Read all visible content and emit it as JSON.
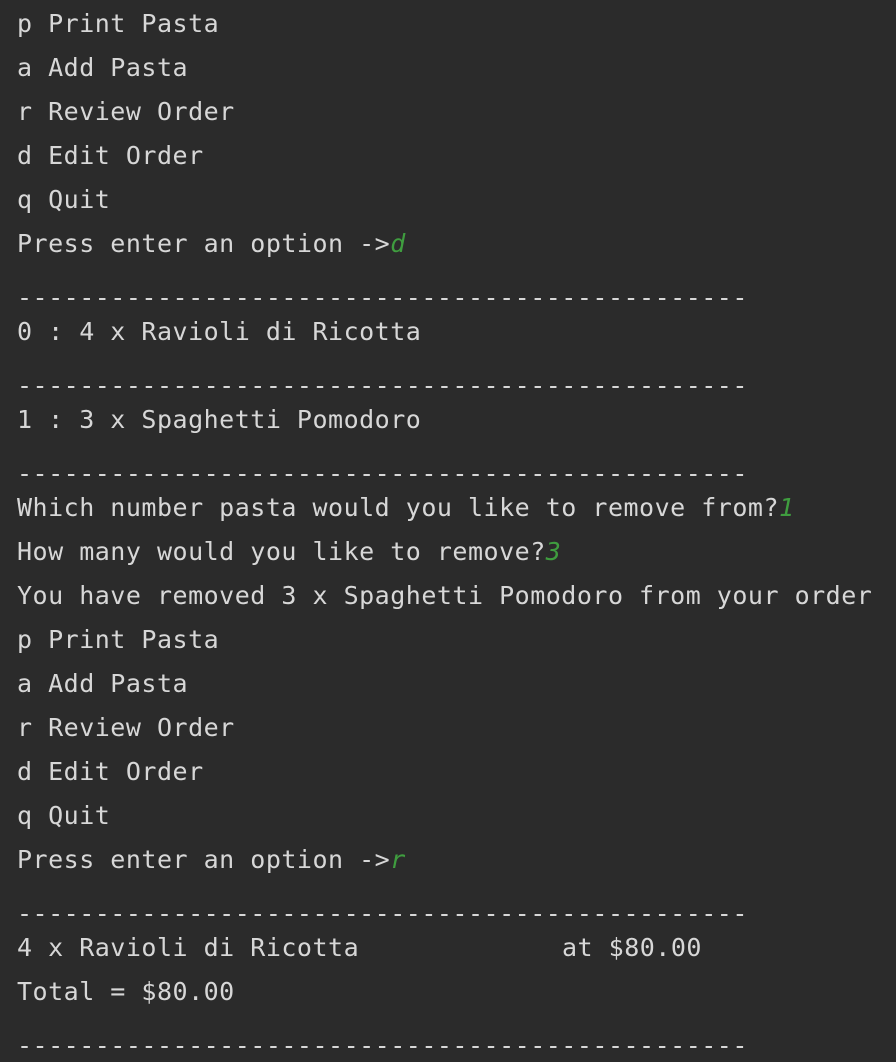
{
  "console": {
    "colors": {
      "background": "#2b2b2b",
      "text": "#d7d7d7",
      "user_input": "#3f9d3f"
    },
    "separator": "-----------------------------------------------",
    "menu1": {
      "p": "p Print Pasta",
      "a": "a Add Pasta",
      "r": "r Review Order",
      "d": "d Edit Order",
      "q": "q Quit",
      "prompt": "Press enter an option ->",
      "input": "d"
    },
    "edit": {
      "item0": "0 : 4 x Ravioli di Ricotta",
      "item1": "1 : 3 x Spaghetti Pomodoro",
      "which_prompt": "Which number pasta would you like to remove from?",
      "which_input": "1",
      "how_prompt": "How many would you like to remove?",
      "how_input": "3",
      "result": "You have removed 3 x Spaghetti Pomodoro from your order"
    },
    "menu2": {
      "p": "p Print Pasta",
      "a": "a Add Pasta",
      "r": "r Review Order",
      "d": "d Edit Order",
      "q": "q Quit",
      "prompt": "Press enter an option ->",
      "input": "r"
    },
    "review": {
      "item": "4 x Ravioli di Ricotta",
      "price": "at $80.00",
      "total": "Total = $80.00"
    }
  }
}
